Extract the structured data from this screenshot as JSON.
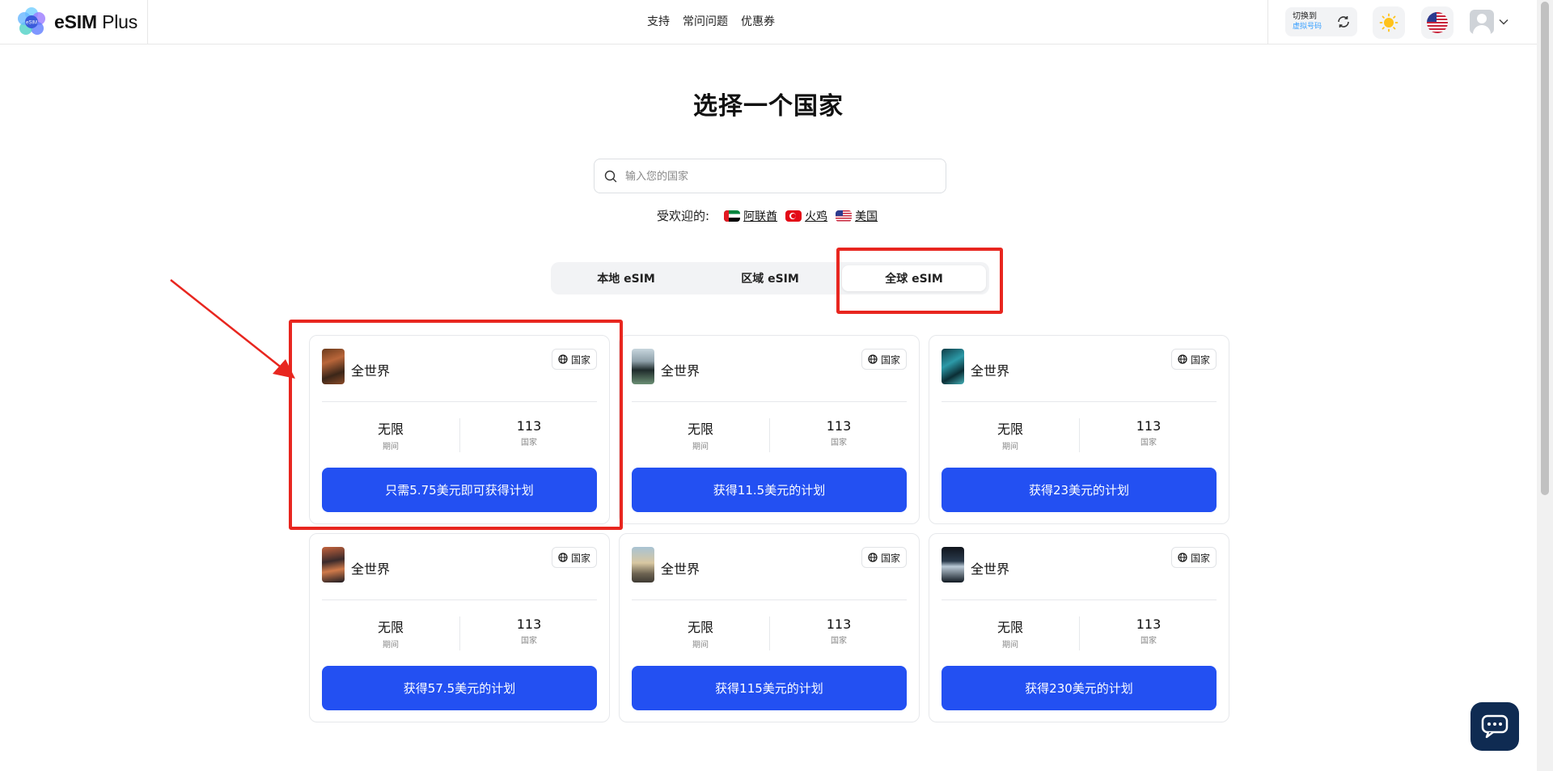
{
  "brand": {
    "logo_text_bold": "eSIM",
    "logo_text_light": " Plus",
    "logo_badge": "eSIM"
  },
  "nav": [
    {
      "label": "支持"
    },
    {
      "label": "常问问题"
    },
    {
      "label": "优惠券"
    }
  ],
  "header": {
    "switch_title": "切换到",
    "switch_sub": "虚拟号码"
  },
  "page": {
    "title": "选择一个国家"
  },
  "search": {
    "placeholder": "输入您的国家",
    "value": ""
  },
  "popular": {
    "label": "受欢迎的:",
    "items": [
      {
        "label": "阿联酋",
        "flag": "flag-ae"
      },
      {
        "label": "火鸡",
        "flag": "flag-tr"
      },
      {
        "label": "美国",
        "flag": "flag-us"
      }
    ]
  },
  "tabs": [
    {
      "label": "本地 eSIM",
      "active": false
    },
    {
      "label": "区域 eSIM",
      "active": false
    },
    {
      "label": "全球 eSIM",
      "active": true
    }
  ],
  "cards": [
    {
      "name": "全世界",
      "badge": "国家",
      "duration": "无限",
      "duration_label": "期间",
      "countries": "113",
      "countries_label": "国家",
      "button": "只需5.75美元即可获得计划"
    },
    {
      "name": "全世界",
      "badge": "国家",
      "duration": "无限",
      "duration_label": "期间",
      "countries": "113",
      "countries_label": "国家",
      "button": "获得11.5美元的计划"
    },
    {
      "name": "全世界",
      "badge": "国家",
      "duration": "无限",
      "duration_label": "期间",
      "countries": "113",
      "countries_label": "国家",
      "button": "获得23美元的计划"
    },
    {
      "name": "全世界",
      "badge": "国家",
      "duration": "无限",
      "duration_label": "期间",
      "countries": "113",
      "countries_label": "国家",
      "button": "获得57.5美元的计划"
    },
    {
      "name": "全世界",
      "badge": "国家",
      "duration": "无限",
      "duration_label": "期间",
      "countries": "113",
      "countries_label": "国家",
      "button": "获得115美元的计划"
    },
    {
      "name": "全世界",
      "badge": "国家",
      "duration": "无限",
      "duration_label": "期间",
      "countries": "113",
      "countries_label": "国家",
      "button": "获得230美元的计划"
    }
  ],
  "colors": {
    "accent": "#2350f2",
    "highlight": "#e8261f",
    "chat": "#0f2b52"
  },
  "icons": {
    "search": "search-icon",
    "globe": "globe-icon",
    "theme": "sun-icon",
    "chat": "chat-icon",
    "switch": "refresh-icon"
  }
}
